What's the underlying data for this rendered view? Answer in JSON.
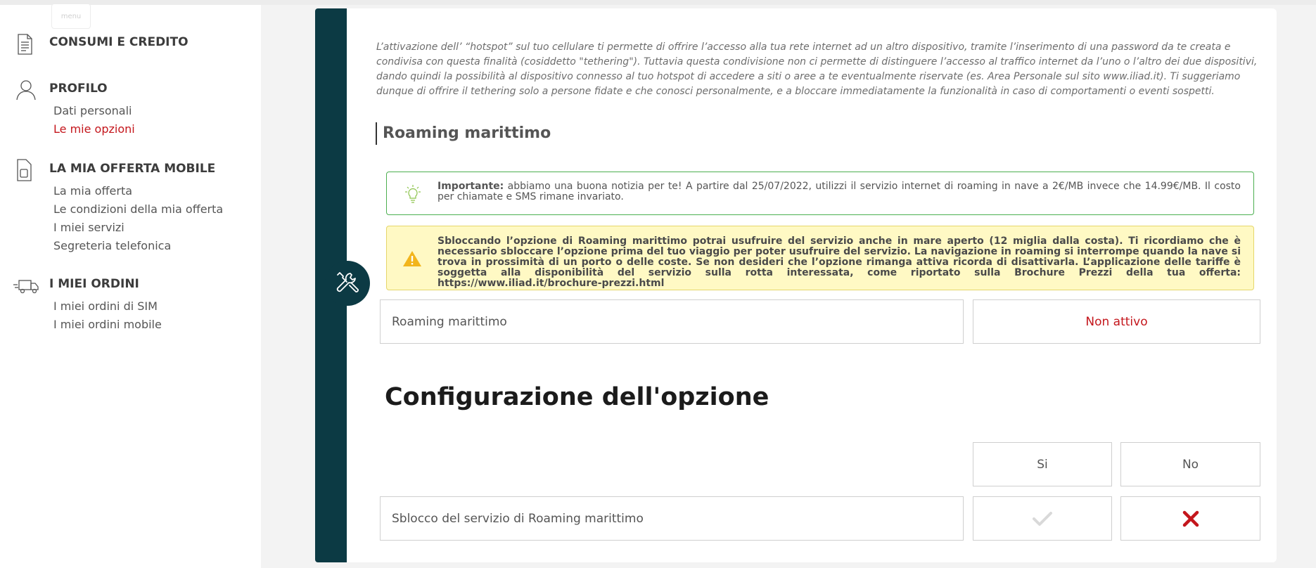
{
  "menu_label": "menu",
  "sidebar": {
    "sections": [
      {
        "title": "CONSUMI E CREDITO",
        "icon": "document-icon",
        "items": []
      },
      {
        "title": "PROFILO",
        "icon": "user-icon",
        "items": [
          "Dati personali",
          "Le mie opzioni"
        ],
        "active_item": "Le mie opzioni"
      },
      {
        "title": "LA MIA OFFERTA MOBILE",
        "icon": "sim-card-icon",
        "items": [
          "La mia offerta",
          "Le condizioni della mia offerta",
          "I miei servizi",
          "Segreteria telefonica"
        ]
      },
      {
        "title": "I MIEI ORDINI",
        "icon": "delivery-truck-icon",
        "items": [
          "I miei ordini di SIM",
          "I miei ordini mobile"
        ]
      }
    ]
  },
  "intro_text": "L’attivazione dell’ “hotspot” sul tuo cellulare ti permette di offrire l’accesso alla tua rete internet ad un altro dispositivo, tramite l’inserimento di una password da te creata e condivisa con questa finalità (cosiddetto \"tethering\"). Tuttavia questa condivisione non ci permette di distinguere l’accesso al traffico internet da l’uno o l’altro dei due dispositivi, dando quindi la possibilità al dispositivo connesso al tuo hotspot di accedere a siti o aree a te eventualmente riservate (es. Area Personale sul sito www.iliad.it). Ti suggeriamo dunque di offrire il tethering solo a persone fidate e che conosci personalmente, e a bloccare immediatamente la funzionalità in caso di comportamenti o eventi sospetti.",
  "section_title": "Roaming marittimo",
  "notice_green": {
    "bold": "Importante:",
    "text": " abbiamo una buona notizia per te! A partire dal 25/07/2022, utilizzi il servizio internet di roaming in nave a 2€/MB invece che 14.99€/MB. Il costo per chiamate e SMS rimane invariato.",
    "icon": "lightbulb-icon"
  },
  "notice_yellow": {
    "text": "Sbloccando l’opzione di Roaming marittimo potrai usufruire del servizio anche in mare aperto (12 miglia dalla costa). Ti ricordiamo che è necessario sbloccare l’opzione prima del tuo viaggio per poter usufruire del servizio. La navigazione in roaming si interrompe quando la nave si trova in prossimità di un porto o delle coste. Se non desideri che l’opzione rimanga attiva ricorda di disattivarla. L’applicazione delle tariffe è soggetta alla disponibilità del servizio sulla rotta interessata, come riportato sulla Brochure Prezzi della tua offerta: https://www.iliad.it/brochure-prezzi.html",
    "icon": "warning-icon"
  },
  "status_row": {
    "label": "Roaming marittimo",
    "status": "Non attivo"
  },
  "config": {
    "title": "Configurazione dell'opzione",
    "yes_label": "Si",
    "no_label": "No",
    "row_label": "Sblocco del servizio di Roaming marittimo",
    "selected": "No"
  },
  "colors": {
    "accent_red": "#c4161c",
    "dark_teal": "#0c3a44",
    "green_border": "#4caf50",
    "warning_bg": "#fff9c4"
  }
}
